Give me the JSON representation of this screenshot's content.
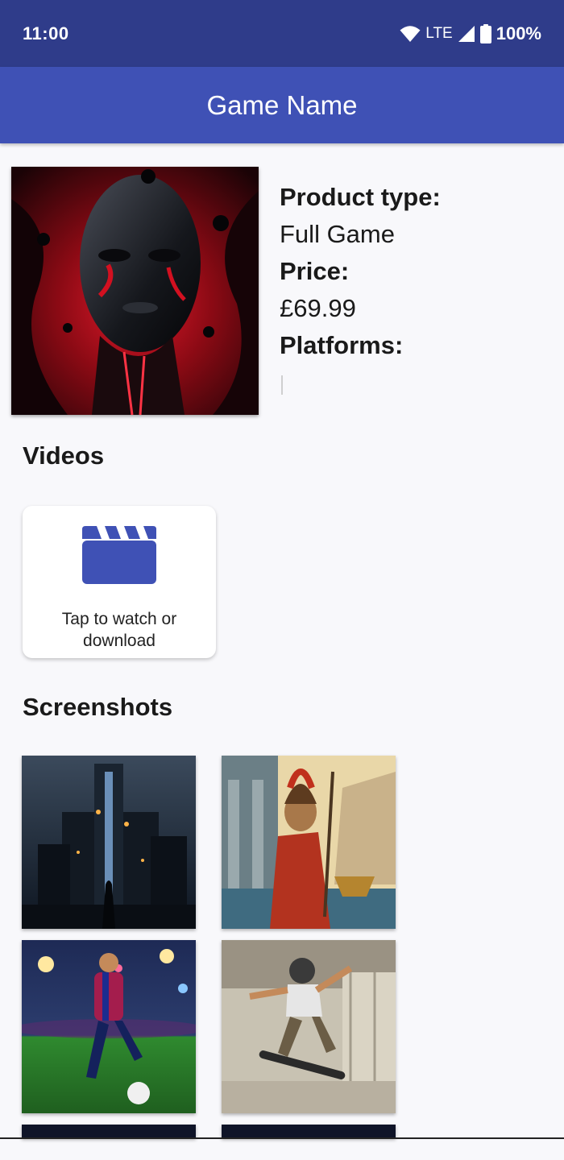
{
  "status_bar": {
    "time": "11:00",
    "network": "LTE",
    "battery": "100%",
    "icons": [
      "wifi-icon",
      "signal-icon",
      "battery-icon"
    ]
  },
  "app_bar": {
    "title": "Game Name"
  },
  "product": {
    "type_label": "Product type:",
    "type_value": "Full Game",
    "price_label": "Price:",
    "price_value": "£69.99",
    "platforms_label": "Platforms:",
    "platforms_value": ""
  },
  "videos": {
    "heading": "Videos",
    "card_icon": "clapperboard-icon",
    "card_caption": "Tap to watch or download"
  },
  "screenshots": {
    "heading": "Screenshots",
    "items": [
      "dark-city-screenshot",
      "spartan-warrior-screenshot",
      "football-player-screenshot",
      "skateboarder-screenshot",
      "screenshot-5",
      "screenshot-6"
    ]
  },
  "colors": {
    "status_bar": "#2f3c8a",
    "app_bar": "#3f51b5",
    "accent": "#3f51b5",
    "background": "#f8f8fb"
  }
}
